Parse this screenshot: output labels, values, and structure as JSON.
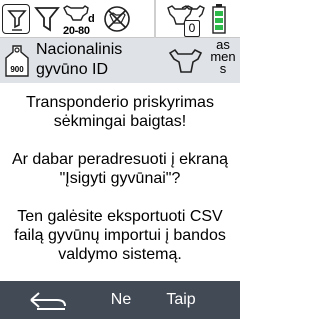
{
  "statusbar": {
    "filter_icon": "filter-list-icon",
    "funnel_icon": "funnel-cow-icon",
    "age_unit": "d",
    "age_range": "20-80",
    "no_cow_icon": "no-cow-icon",
    "cow_count": "0",
    "battery_icon": "battery-icon",
    "battery_color": "#2db84a"
  },
  "header": {
    "tag_label": "900",
    "title": "Nacionalinis gyvūno ID",
    "cow_icon": "cow-outline-icon",
    "sex_label": "as men s"
  },
  "message": {
    "line1": "Transponderio priskyrimas sėkmingai baigtas!",
    "line2": "Ar dabar peradresuoti į ekraną \"Įsigyti gyvūnai\"?",
    "line3": "Ten galėsite eksportuoti CSV failą gyvūnų importui į bandos valdymo sistemą."
  },
  "actions": {
    "back_icon": "return-arrow-icon",
    "no_label": "Ne",
    "yes_label": "Taip"
  },
  "colors": {
    "header_bg": "#dfe2e7",
    "bottom_bar_bg": "#424a55"
  }
}
